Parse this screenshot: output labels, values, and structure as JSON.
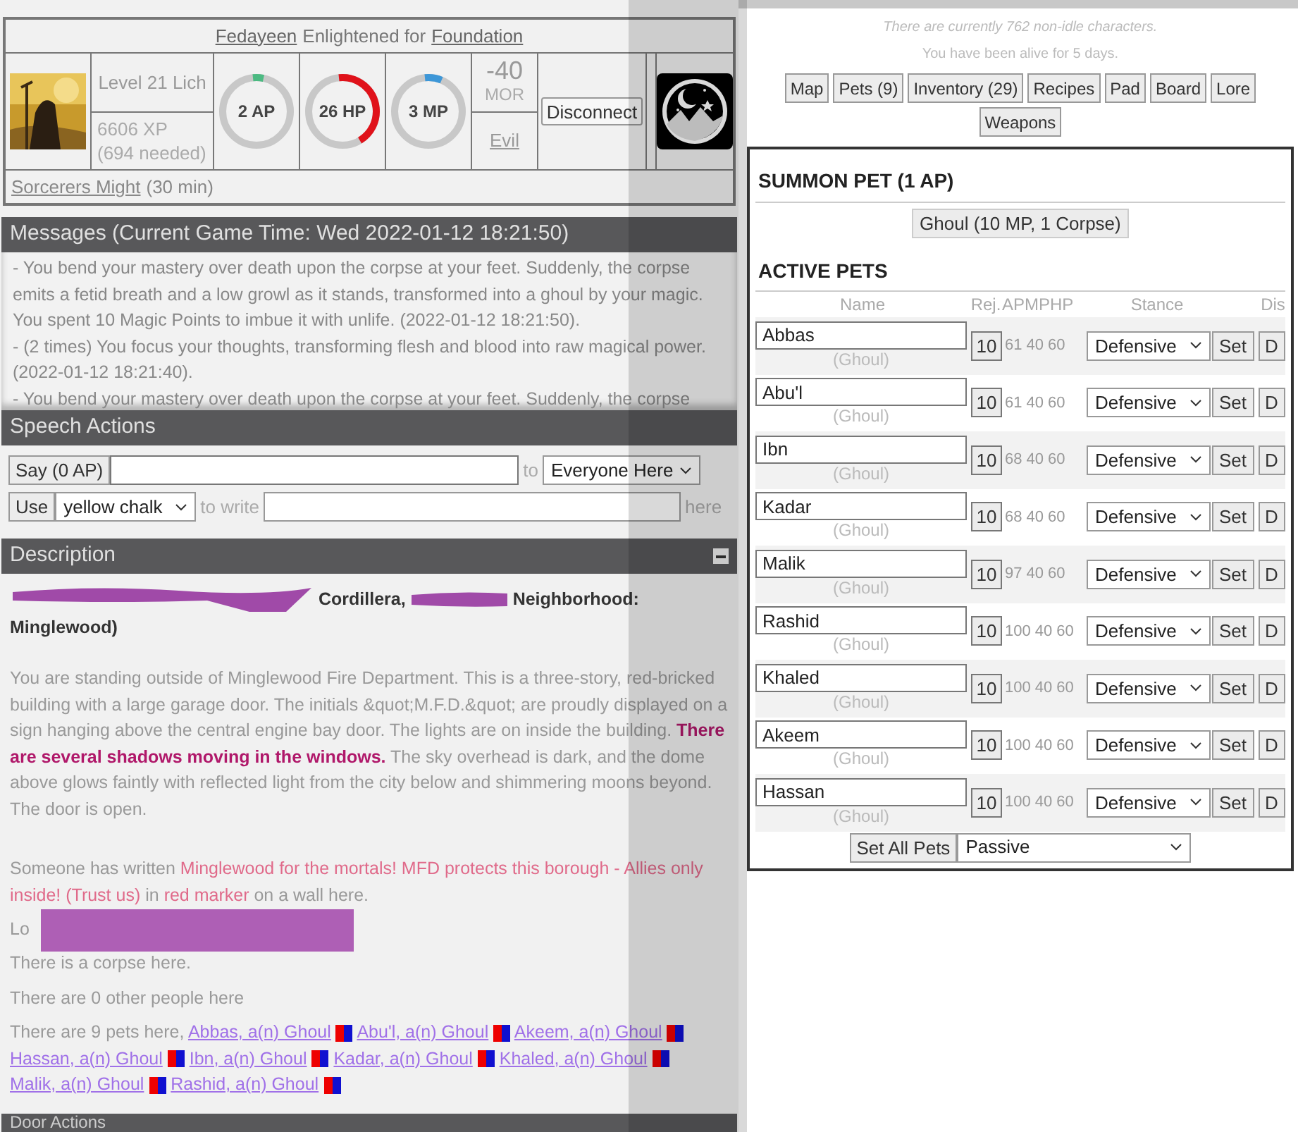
{
  "character": {
    "name": "Fedayeen",
    "rank_text": "Enlightened for",
    "faction": "Foundation",
    "level": "Level 21 Lich",
    "xp": "6606 XP (694 needed)",
    "morality": "-40",
    "morality_label": "MOR",
    "alignment": "Evil",
    "effect": "Sorcerers Might",
    "effect_duration": "(30 min)",
    "disconnect": "Disconnect",
    "stats": [
      {
        "label": "2 AP",
        "level": 0.05,
        "color": "#4cba82"
      },
      {
        "label": "26 HP",
        "level": 0.43,
        "color": "#e0121a"
      },
      {
        "label": "3 MP",
        "level": 0.08,
        "color": "#3d97d8"
      }
    ]
  },
  "messages": {
    "title": "Messages (Current Game Time: Wed 2022-01-12 18:21:50)",
    "entries": [
      "- You bend your mastery over death upon the corpse at your feet. Suddenly, the corpse emits a fetid breath and a low growl as it stands, transformed into a ghoul by your magic. You spent 10 Magic Points to imbue it with unlife. (2022-01-12 18:21:50).",
      "- (2 times) You focus your thoughts, transforming flesh and blood into raw magical power. (2022-01-12 18:21:40).",
      "- You bend your mastery over death upon the corpse at your feet. Suddenly, the corpse"
    ]
  },
  "speech": {
    "title": "Speech Actions",
    "say_button": "Say (0 AP)",
    "to": "to",
    "target": "Everyone Here",
    "use_button": "Use",
    "item": "yellow chalk",
    "to_write": "to write",
    "here": "here"
  },
  "description": {
    "title": "Description",
    "location_parts": [
      "Cordillera,",
      "Neighborhood:",
      "Minglewood)"
    ],
    "text": "You are standing outside of Minglewood Fire Department. This is a three-story, red-bricked building with a large garage door. The initials &quot;M.F.D.&quot; are proudly displayed on a sign hanging above the central engine bay door. The lights are on inside the building. **There are several shadows moving in the windows.** The sky overhead is dark, and the dome above glows faintly with reflected light from the city below and shimmering moons beyond. The door is open.",
    "writing": [
      {
        "kind": "plain",
        "text": "Someone has written "
      },
      {
        "kind": "marker",
        "text": "Minglewood for the mortals! MFD protects this borough - Allies only inside! (Trust us)"
      },
      {
        "kind": "plain",
        "text": " in "
      },
      {
        "kind": "marker",
        "text": "red marker"
      },
      {
        "kind": "plain",
        "text": " on a wall here."
      }
    ],
    "located": "Lo",
    "corpse": "There is a corpse here.",
    "people": "There are 0 other people here",
    "pets_intro": "There are 9 pets here, ",
    "pets_here": [
      "Abbas, a(n) Ghoul",
      "Abu'l, a(n) Ghoul",
      "Akeem, a(n) Ghoul",
      "Hassan, a(n) Ghoul",
      "Ibn, a(n) Ghoul",
      "Kadar, a(n) Ghoul",
      "Khaled, a(n) Ghoul",
      "Malik, a(n) Ghoul",
      "Rashid, a(n) Ghoul"
    ]
  },
  "door_actions": {
    "title": "Door Actions"
  },
  "status": {
    "online": "There are currently 762 non-idle characters.",
    "alive": "You have been alive for 5 days."
  },
  "nav_buttons": [
    "Map",
    "Pets (9)",
    "Inventory (29)",
    "Recipes",
    "Pad",
    "Board",
    "Lore",
    "Weapons"
  ],
  "pets_panel": {
    "summon_title": "SUMMON PET (1 AP)",
    "summon_button": "Ghoul (10 MP, 1 Corpse)",
    "active_title": "ACTIVE PETS",
    "columns": [
      "Name",
      "Rej.",
      "AP",
      "MP",
      "HP",
      "Stance",
      "Dis"
    ],
    "pets": [
      {
        "name": "Abbas",
        "type": "(Ghoul)",
        "rej": "10",
        "ap": "61",
        "mp": "40",
        "hp": "60",
        "stance": "Defensive",
        "set_button": "Set",
        "dismiss_button": "D"
      },
      {
        "name": "Abu'l",
        "type": "(Ghoul)",
        "rej": "10",
        "ap": "61",
        "mp": "40",
        "hp": "60",
        "stance": "Defensive",
        "set_button": "Set",
        "dismiss_button": "D"
      },
      {
        "name": "Ibn",
        "type": "(Ghoul)",
        "rej": "10",
        "ap": "68",
        "mp": "40",
        "hp": "60",
        "stance": "Defensive",
        "set_button": "Set",
        "dismiss_button": "D"
      },
      {
        "name": "Kadar",
        "type": "(Ghoul)",
        "rej": "10",
        "ap": "68",
        "mp": "40",
        "hp": "60",
        "stance": "Defensive",
        "set_button": "Set",
        "dismiss_button": "D"
      },
      {
        "name": "Malik",
        "type": "(Ghoul)",
        "rej": "10",
        "ap": "97",
        "mp": "40",
        "hp": "60",
        "stance": "Defensive",
        "set_button": "Set",
        "dismiss_button": "D"
      },
      {
        "name": "Rashid",
        "type": "(Ghoul)",
        "rej": "10",
        "ap": "100",
        "mp": "40",
        "hp": "60",
        "stance": "Defensive",
        "set_button": "Set",
        "dismiss_button": "D"
      },
      {
        "name": "Khaled",
        "type": "(Ghoul)",
        "rej": "10",
        "ap": "100",
        "mp": "40",
        "hp": "60",
        "stance": "Defensive",
        "set_button": "Set",
        "dismiss_button": "D"
      },
      {
        "name": "Akeem",
        "type": "(Ghoul)",
        "rej": "10",
        "ap": "100",
        "mp": "40",
        "hp": "60",
        "stance": "Defensive",
        "set_button": "Set",
        "dismiss_button": "D"
      },
      {
        "name": "Hassan",
        "type": "(Ghoul)",
        "rej": "10",
        "ap": "100",
        "mp": "40",
        "hp": "60",
        "stance": "Defensive",
        "set_button": "Set",
        "dismiss_button": "D"
      }
    ],
    "set_all_button": "Set All Pets",
    "set_all_stance": "Passive"
  }
}
